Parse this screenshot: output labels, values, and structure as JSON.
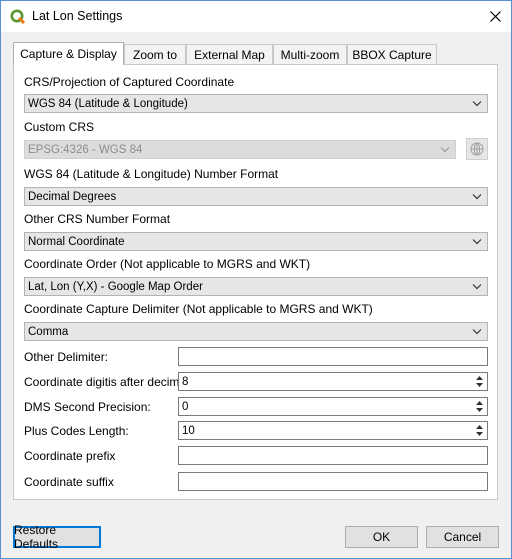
{
  "window": {
    "title": "Lat Lon Settings"
  },
  "tabs": [
    {
      "label": "Capture & Display",
      "active": true
    },
    {
      "label": "Zoom to"
    },
    {
      "label": "External Map"
    },
    {
      "label": "Multi-zoom"
    },
    {
      "label": "BBOX Capture"
    }
  ],
  "capture": {
    "crs_label": "CRS/Projection of Captured Coordinate",
    "crs_value": "WGS 84 (Latitude & Longitude)",
    "custom_crs_label": "Custom CRS",
    "custom_crs_value": "EPSG:4326 - WGS 84",
    "wgs_format_label": "WGS 84 (Latitude & Longitude) Number Format",
    "wgs_format_value": "Decimal Degrees",
    "other_format_label": "Other CRS Number Format",
    "other_format_value": "Normal Coordinate",
    "order_label": "Coordinate Order (Not applicable to MGRS and WKT)",
    "order_value": "Lat, Lon (Y,X) - Google Map Order",
    "delimiter_label": "Coordinate Capture Delimiter (Not applicable to MGRS and WKT)",
    "delimiter_value": "Comma",
    "other_delimiter_label": "Other Delimiter:",
    "other_delimiter_value": "",
    "digits_label": "Coordinate digitis after decimal",
    "digits_value": "8",
    "dms_label": "DMS Second Precision:",
    "dms_value": "0",
    "plus_label": "Plus Codes Length:",
    "plus_value": "10",
    "prefix_label": "Coordinate prefix",
    "prefix_value": "",
    "suffix_label": "Coordinate suffix",
    "suffix_value": ""
  },
  "footer": {
    "restore_label": "Restore Defaults",
    "ok_label": "OK",
    "cancel_label": "Cancel"
  },
  "colors": {
    "accent": "#0078d7",
    "qgis_green": "#589632",
    "qgis_yellow": "#ee7913"
  }
}
